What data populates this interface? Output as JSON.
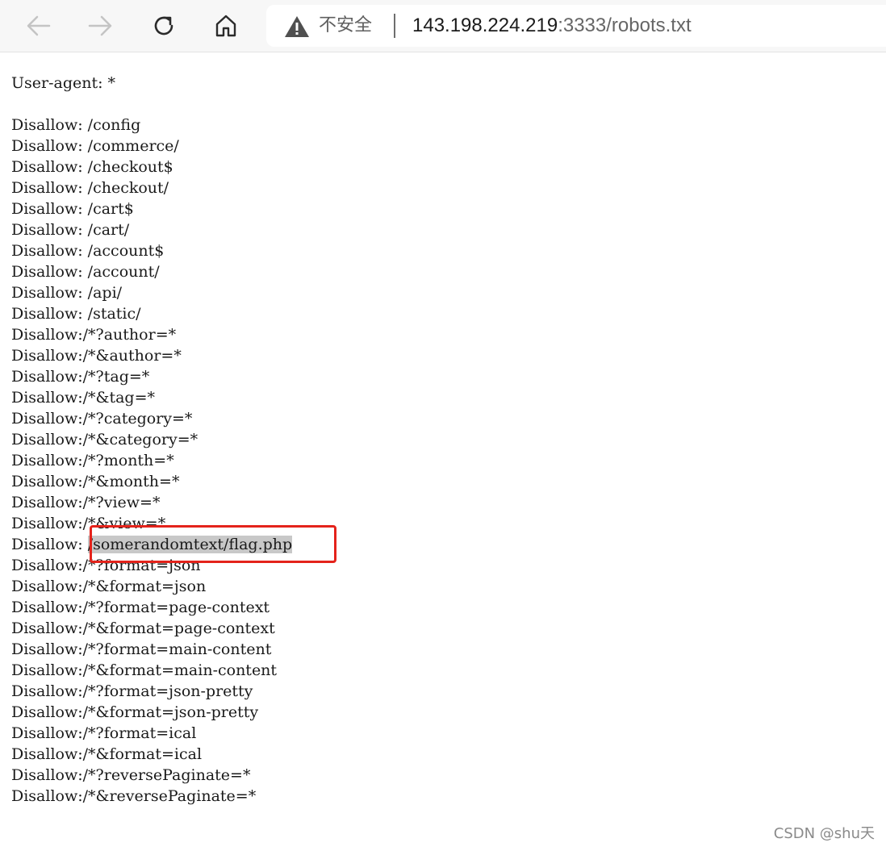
{
  "browser": {
    "security_label": "不安全",
    "url_host": "143.198.224.219",
    "url_path": ":3333/robots.txt"
  },
  "robots": {
    "lines": [
      "User-agent: *",
      "",
      "Disallow: /config",
      "Disallow: /commerce/",
      "Disallow: /checkout$",
      "Disallow: /checkout/",
      "Disallow: /cart$",
      "Disallow: /cart/",
      "Disallow: /account$",
      "Disallow: /account/",
      "Disallow: /api/",
      "Disallow: /static/",
      "Disallow:/*?author=*",
      "Disallow:/*&author=*",
      "Disallow:/*?tag=*",
      "Disallow:/*&tag=*",
      "Disallow:/*?category=*",
      "Disallow:/*&category=*",
      "Disallow:/*?month=*",
      "Disallow:/*&month=*",
      "Disallow:/*?view=*",
      "Disallow:/*&view=*",
      "Disallow: ",
      "Disallow:/*?format=json",
      "Disallow:/*&format=json",
      "Disallow:/*?format=page-context",
      "Disallow:/*&format=page-context",
      "Disallow:/*?format=main-content",
      "Disallow:/*&format=main-content",
      "Disallow:/*?format=json-pretty",
      "Disallow:/*&format=json-pretty",
      "Disallow:/*?format=ical",
      "Disallow:/*&format=ical",
      "Disallow:/*?reversePaginate=*",
      "Disallow:/*&reversePaginate=*"
    ],
    "highlighted_path": "/somerandomtext/flag.php"
  },
  "watermark": "CSDN @shu天",
  "colors": {
    "highlight_box": "#e4231b",
    "selection": "#c8c8c8"
  }
}
